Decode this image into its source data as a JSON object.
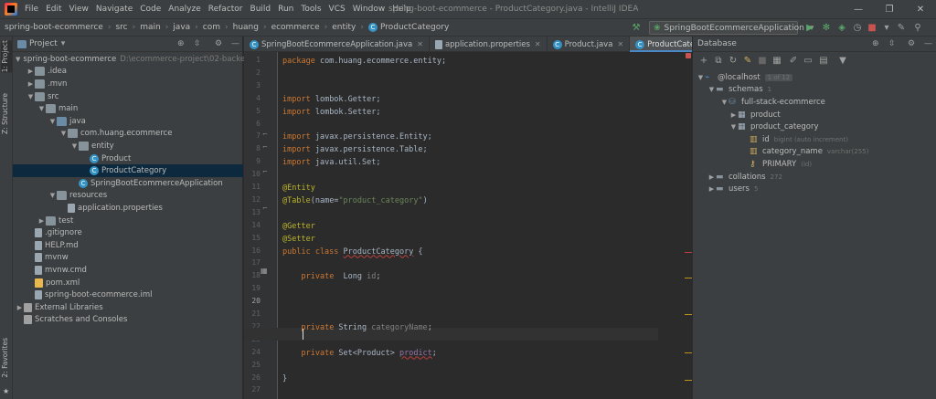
{
  "menu": [
    "File",
    "Edit",
    "View",
    "Navigate",
    "Code",
    "Analyze",
    "Refactor",
    "Build",
    "Run",
    "Tools",
    "VCS",
    "Window",
    "Help"
  ],
  "window_title": "spring-boot-ecommerce - ProductCategory.java - IntelliJ IDEA",
  "breadcrumbs": [
    "spring-boot-ecommerce",
    "src",
    "main",
    "java",
    "com",
    "huang",
    "ecommerce",
    "entity",
    "ProductCategory"
  ],
  "run_config": "SpringBootEcommerceApplication",
  "side_labels": {
    "project": "1: Project",
    "structure": "Z: Structure",
    "favorites": "2: Favorites"
  },
  "project": {
    "title": "Project",
    "tree": [
      {
        "label": "spring-boot-ecommerce",
        "extra": "D:\\ecommerce-project\\02-backen",
        "indent": 0,
        "arrow": "▼",
        "icon": "folder blue"
      },
      {
        "label": ".idea",
        "indent": 1,
        "arrow": "▶",
        "icon": "folder"
      },
      {
        "label": ".mvn",
        "indent": 1,
        "arrow": "▶",
        "icon": "folder"
      },
      {
        "label": "src",
        "indent": 1,
        "arrow": "▼",
        "icon": "folder"
      },
      {
        "label": "main",
        "indent": 2,
        "arrow": "▼",
        "icon": "folder"
      },
      {
        "label": "java",
        "indent": 3,
        "arrow": "▼",
        "icon": "folder blue"
      },
      {
        "label": "com.huang.ecommerce",
        "indent": 4,
        "arrow": "▼",
        "icon": "pkg"
      },
      {
        "label": "entity",
        "indent": 5,
        "arrow": "▼",
        "icon": "pkg"
      },
      {
        "label": "Product",
        "indent": 6,
        "arrow": "",
        "icon": "cls"
      },
      {
        "label": "ProductCategory",
        "indent": 6,
        "arrow": "",
        "icon": "cls",
        "selected": true
      },
      {
        "label": "SpringBootEcommerceApplication",
        "indent": 5,
        "arrow": "",
        "icon": "cls"
      },
      {
        "label": "resources",
        "indent": 3,
        "arrow": "▼",
        "icon": "folder"
      },
      {
        "label": "application.properties",
        "indent": 4,
        "arrow": "",
        "icon": "file"
      },
      {
        "label": "test",
        "indent": 2,
        "arrow": "▶",
        "icon": "folder"
      },
      {
        "label": ".gitignore",
        "indent": 1,
        "arrow": "",
        "icon": "file"
      },
      {
        "label": "HELP.md",
        "indent": 1,
        "arrow": "",
        "icon": "file"
      },
      {
        "label": "mvnw",
        "indent": 1,
        "arrow": "",
        "icon": "file"
      },
      {
        "label": "mvnw.cmd",
        "indent": 1,
        "arrow": "",
        "icon": "file"
      },
      {
        "label": "pom.xml",
        "indent": 1,
        "arrow": "",
        "icon": "xmlf"
      },
      {
        "label": "spring-boot-ecommerce.iml",
        "indent": 1,
        "arrow": "",
        "icon": "file"
      },
      {
        "label": "External Libraries",
        "indent": 0,
        "arrow": "▶",
        "icon": "lib"
      },
      {
        "label": "Scratches and Consoles",
        "indent": 0,
        "arrow": "",
        "icon": "lib"
      }
    ]
  },
  "tabs": [
    {
      "label": "SpringBootEcommerceApplication.java",
      "active": false
    },
    {
      "label": "application.properties",
      "active": false
    },
    {
      "label": "Product.java",
      "active": false
    },
    {
      "label": "ProductCategory.java",
      "active": true
    }
  ],
  "code_lines": [
    "<span class=\"kw\">package</span> com.huang.ecommerce.entity;",
    "",
    "",
    "<span class=\"kw\">import</span> lombok.Getter;",
    "<span class=\"kw\">import</span> lombok.Setter;",
    "",
    "<span class=\"kw\">import</span> javax.persistence.Entity;",
    "<span class=\"kw\">import</span> javax.persistence.Table;",
    "<span class=\"kw\">import</span> java.util.Set;",
    "",
    "<span class=\"an\">@Entity</span>",
    "<span class=\"an\">@Table</span>(name=<span class=\"st\">\"product_category\"</span>)",
    "",
    "<span class=\"an\">@Getter</span>",
    "<span class=\"an\">@Setter</span>",
    "<span class=\"kw\">public class</span> <span class=\"un\">ProductCategory</span> {",
    "",
    "    <span class=\"kw\">private</span>  Long <span class=\"gr\">id</span>;",
    "",
    "    ",
    "",
    "    <span class=\"kw\">private</span> String <span class=\"gr\">categoryName</span>;",
    "",
    "    <span class=\"kw\">private</span> Set&lt;Product&gt; <span class=\"fd un\">prodict</span>;",
    "",
    "}",
    ""
  ],
  "db": {
    "title": "Database",
    "rows": [
      {
        "label": "@localhost",
        "extra": "1 of 12",
        "x": 4,
        "arrow": "▼",
        "icon": "conn"
      },
      {
        "label": "schemas",
        "extra": "1",
        "x": 16,
        "arrow": "▼",
        "icon": "folder"
      },
      {
        "label": "full-stack-ecommerce",
        "extra": "",
        "x": 30,
        "arrow": "▼",
        "icon": "schema"
      },
      {
        "label": "product",
        "extra": "",
        "x": 40,
        "arrow": "▶",
        "icon": "table"
      },
      {
        "label": "product_category",
        "extra": "",
        "x": 40,
        "arrow": "▼",
        "icon": "table"
      },
      {
        "label": "id",
        "extra": "bigint (auto increment)",
        "x": 62,
        "arrow": "",
        "icon": "col"
      },
      {
        "label": "category_name",
        "extra": "varchar(255)",
        "x": 62,
        "arrow": "",
        "icon": "col"
      },
      {
        "label": "PRIMARY",
        "extra": "(id)",
        "x": 62,
        "arrow": "",
        "icon": "key"
      },
      {
        "label": "collations",
        "extra": "272",
        "x": 16,
        "arrow": "▶",
        "icon": "folder"
      },
      {
        "label": "users",
        "extra": "5",
        "x": 16,
        "arrow": "▶",
        "icon": "folder"
      }
    ]
  },
  "colors": {
    "accent": "#4a88c7",
    "selection": "#0d293e",
    "background": "#2b2b2b",
    "panel": "#3c3f41"
  }
}
